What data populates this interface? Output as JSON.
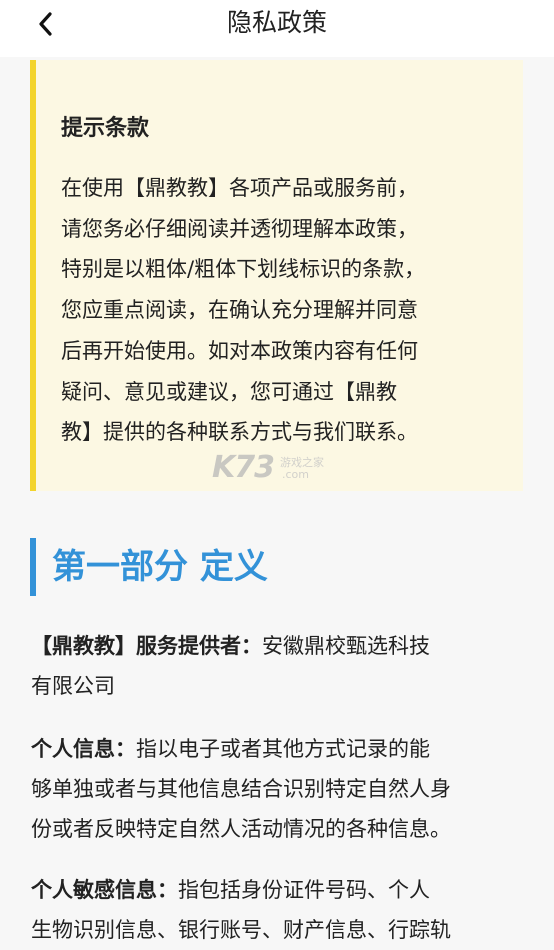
{
  "header": {
    "back_icon": "chevron-left-icon",
    "title": "隐私政策"
  },
  "notice": {
    "title": "提示条款",
    "lines": [
      "在使用【鼎教教】各项产品或服务前，",
      "请您务必仔细阅读并透彻理解本政策，",
      "特别是以粗体/粗体下划线标识的条款，",
      "您应重点阅读，在确认充分理解并同意",
      "后再开始使用。如对本政策内容有任何",
      "疑问、意见或建议，您可通过【鼎教",
      "教】提供的各种联系方式与我们联系。"
    ]
  },
  "watermark": {
    "logo": "K73",
    "cn": "游戏之家",
    "com": ".com"
  },
  "section": {
    "heading": "第一部分 定义"
  },
  "definitions": [
    {
      "term": "【鼎教教】服务提供者：",
      "lines": [
        "安徽鼎校甄选科技",
        "有限公司"
      ]
    },
    {
      "term": "个人信息：",
      "lines": [
        "指以电子或者其他方式记录的能",
        "够单独或者与其他信息结合识别特定自然人身",
        "份或者反映特定自然人活动情况的各种信息。"
      ]
    },
    {
      "term": "个人敏感信息：",
      "lines": [
        "指包括身份证件号码、个人",
        "生物识别信息、银行账号、财产信息、行踪轨"
      ]
    }
  ],
  "colors": {
    "accent_blue": "#3392d8",
    "notice_bg": "#fcf8e3",
    "notice_border": "#f3d42b",
    "page_bg": "#f7f7f7"
  }
}
